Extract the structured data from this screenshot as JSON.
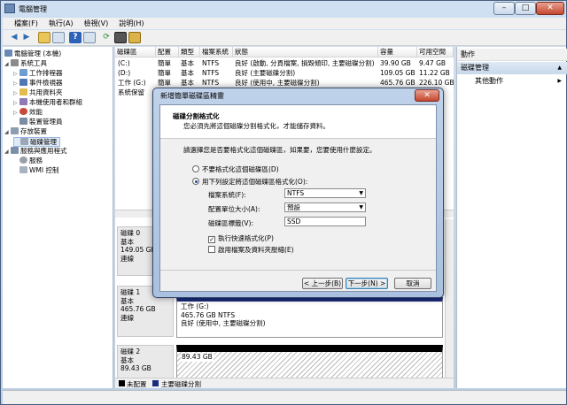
{
  "window": {
    "title": "電腦管理"
  },
  "menu": [
    "檔案(F)",
    "執行(A)",
    "檢視(V)",
    "說明(H)"
  ],
  "tree": [
    {
      "label": "電腦管理 (本機)",
      "level": 0,
      "toggle": ""
    },
    {
      "label": "系統工具",
      "level": 1,
      "toggle": "◢"
    },
    {
      "label": "工作排程器",
      "level": 2,
      "toggle": "▷"
    },
    {
      "label": "事件檢視器",
      "level": 2,
      "toggle": "▷"
    },
    {
      "label": "共用資料夾",
      "level": 2,
      "toggle": "▷"
    },
    {
      "label": "本機使用者和群組",
      "level": 2,
      "toggle": "▷"
    },
    {
      "label": "效能",
      "level": 2,
      "toggle": "▷"
    },
    {
      "label": "裝置管理員",
      "level": 2,
      "toggle": ""
    },
    {
      "label": "存放裝置",
      "level": 1,
      "toggle": "◢"
    },
    {
      "label": "磁碟管理",
      "level": 2,
      "toggle": "",
      "selected": true
    },
    {
      "label": "服務與應用程式",
      "level": 1,
      "toggle": "◢"
    },
    {
      "label": "服務",
      "level": 2,
      "toggle": ""
    },
    {
      "label": "WMI 控制",
      "level": 2,
      "toggle": ""
    }
  ],
  "volume_table": {
    "headers": [
      "磁碟區",
      "配置",
      "類型",
      "檔案系統",
      "狀態",
      "容量",
      "可用空間"
    ],
    "rows": [
      [
        "(C:)",
        "簡單",
        "基本",
        "NTFS",
        "良好 (啟動, 分頁檔案, 損毀傾印, 主要磁碟分割)",
        "39.90 GB",
        "9.47 GB"
      ],
      [
        "(D:)",
        "簡單",
        "基本",
        "NTFS",
        "良好 (主要磁碟分割)",
        "109.05 GB",
        "11.22 GB"
      ],
      [
        "工作 (G:)",
        "簡單",
        "基本",
        "NTFS",
        "良好 (使用中, 主要磁碟分割)",
        "465.76 GB",
        "226.10 GB"
      ],
      [
        "系統保留",
        "",
        "",
        "",
        "",
        "",
        ""
      ]
    ]
  },
  "disks": [
    {
      "name": "磁碟 0",
      "type": "基本",
      "size": "149.05 GB",
      "status": "連線"
    },
    {
      "name": "磁碟 1",
      "type": "基本",
      "size": "465.76 GB",
      "status": "連線",
      "part_title": "工作 (G:)",
      "part_size": "465.76 GB NTFS",
      "part_status": "良好 (使用中, 主要磁碟分割)"
    },
    {
      "name": "磁碟 2",
      "type": "基本",
      "size": "89.43 GB",
      "part_size": "89.43 GB"
    }
  ],
  "legend": {
    "unallocated": "未配置",
    "primary": "主要磁碟分割"
  },
  "actions": {
    "header": "動作",
    "section": "磁碟管理",
    "more": "其他動作"
  },
  "dialog": {
    "title": "新增簡單磁碟區精靈",
    "heading": "磁碟分割格式化",
    "subheading": "您必須先將這個磁碟分割格式化，才能儲存資料。",
    "prompt": "請選擇您是否要格式化這個磁碟區，如果要，您要使用什麼設定。",
    "radio_no": "不要格式化這個磁碟區(D)",
    "radio_yes": "用下列設定將這個磁碟區格式化(O):",
    "fs_label": "檔案系統(F):",
    "fs_value": "NTFS",
    "alloc_label": "配置單位大小(A):",
    "alloc_value": "預設",
    "vol_label": "磁碟區標籤(V):",
    "vol_value": "SSD",
    "quick_format": "執行快速格式化(P)",
    "compress": "啟用檔案及資料夾壓縮(E)",
    "back": "< 上一步(B)",
    "next": "下一步(N) >",
    "cancel": "取消"
  }
}
